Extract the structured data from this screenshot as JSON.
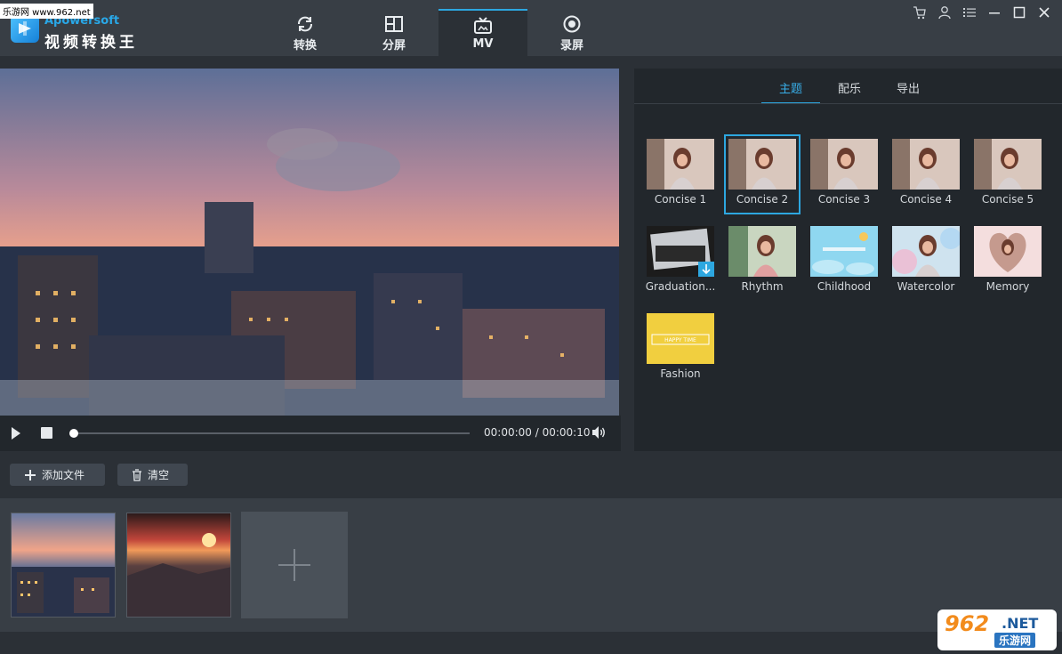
{
  "watermark_site": "乐游网 www.962.net",
  "brand": {
    "sub": "Apowersoft",
    "name": "视频转换王"
  },
  "tabs": [
    {
      "label": "转换",
      "icon": "refresh-icon"
    },
    {
      "label": "分屏",
      "icon": "split-screen-icon"
    },
    {
      "label": "MV",
      "icon": "tv-icon"
    },
    {
      "label": "录屏",
      "icon": "record-icon"
    }
  ],
  "active_tab": "MV",
  "window_controls": [
    "cart-icon",
    "user-icon",
    "menu-icon",
    "minimize-icon",
    "maximize-icon",
    "close-icon"
  ],
  "player": {
    "time": "00:00:00 / 00:00:10",
    "progress": 0
  },
  "right_tabs": [
    {
      "label": "主题"
    },
    {
      "label": "配乐"
    },
    {
      "label": "导出"
    }
  ],
  "themes": [
    {
      "label": "Concise 1"
    },
    {
      "label": "Concise 2"
    },
    {
      "label": "Concise 3"
    },
    {
      "label": "Concise 4"
    },
    {
      "label": "Concise 5"
    },
    {
      "label": "Graduation..."
    },
    {
      "label": "Rhythm"
    },
    {
      "label": "Childhood"
    },
    {
      "label": "Watercolor"
    },
    {
      "label": "Memory"
    },
    {
      "label": "Fashion"
    }
  ],
  "selected_theme": "Concise 2",
  "fashion_banner_text": "HAPPY TIME",
  "toolbar": {
    "add_label": "添加文件",
    "clear_label": "清空"
  },
  "watermark_962": {
    "num": "962",
    "net": ".NET",
    "cn": "乐游网"
  },
  "colors": {
    "accent": "#2da7e0",
    "panel": "#22272c",
    "titlebar": "#383e45"
  }
}
